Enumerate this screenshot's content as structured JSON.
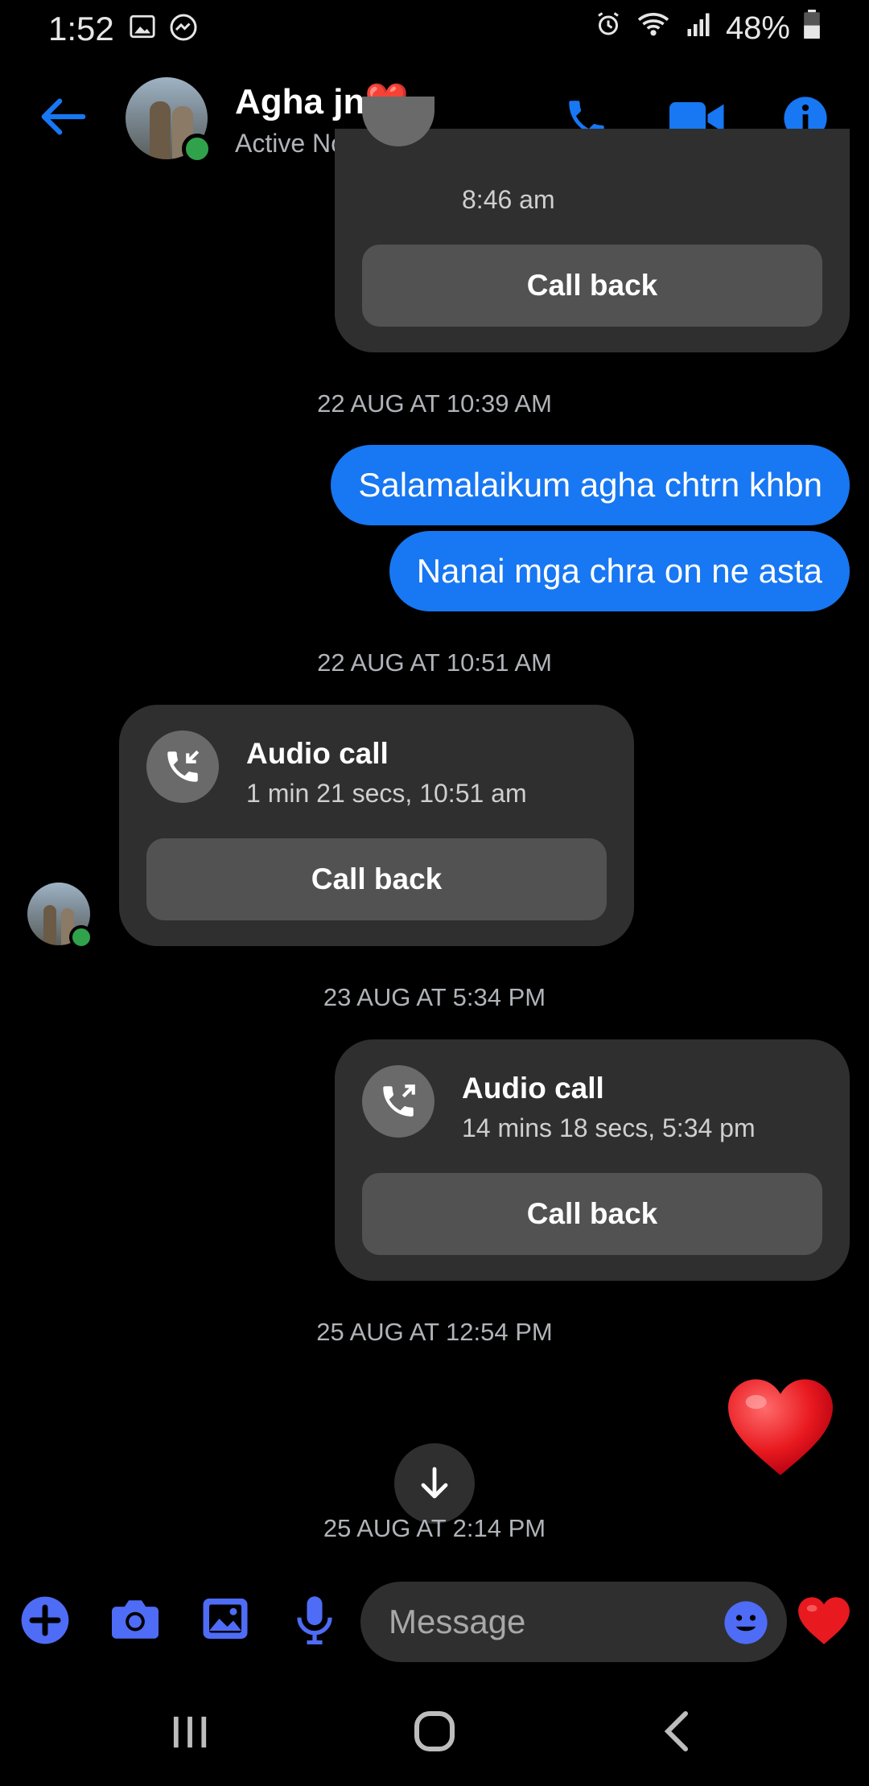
{
  "status_bar": {
    "time": "1:52",
    "battery_percent": "48%"
  },
  "header": {
    "contact_name": "Agha jn❤️",
    "active_status": "Active Now",
    "accent_color": "#1877f2"
  },
  "messages": {
    "top_card": {
      "time_text": "8:46 am",
      "callback_label": "Call back"
    },
    "ts1": "22 AUG AT 10:39 AM",
    "bubble1": "Salamalaikum agha chtrn khbn",
    "bubble2": "Nanai mga chra on ne asta",
    "ts2": "22 AUG AT 10:51 AM",
    "card_incoming": {
      "title": "Audio call",
      "subtitle": "1 min 21 secs, 10:51 am",
      "callback_label": "Call back"
    },
    "ts3": "23 AUG AT 5:34 PM",
    "card_outgoing": {
      "title": "Audio call",
      "subtitle": "14 mins 18 secs, 5:34 pm",
      "callback_label": "Call back"
    },
    "ts4": "25 AUG AT 12:54 PM",
    "heart_emoji": "❤️",
    "ts5": "25 AUG AT 2:14 PM"
  },
  "composer": {
    "placeholder": "Message",
    "like_emoji": "❤️"
  },
  "icons": {
    "back": "back-arrow-icon",
    "call": "phone-icon",
    "video": "video-camera-icon",
    "info": "info-icon",
    "plus": "plus-icon",
    "camera": "camera-icon",
    "gallery": "gallery-icon",
    "mic": "microphone-icon",
    "emoji": "emoji-icon",
    "scroll_down": "arrow-down-icon"
  }
}
